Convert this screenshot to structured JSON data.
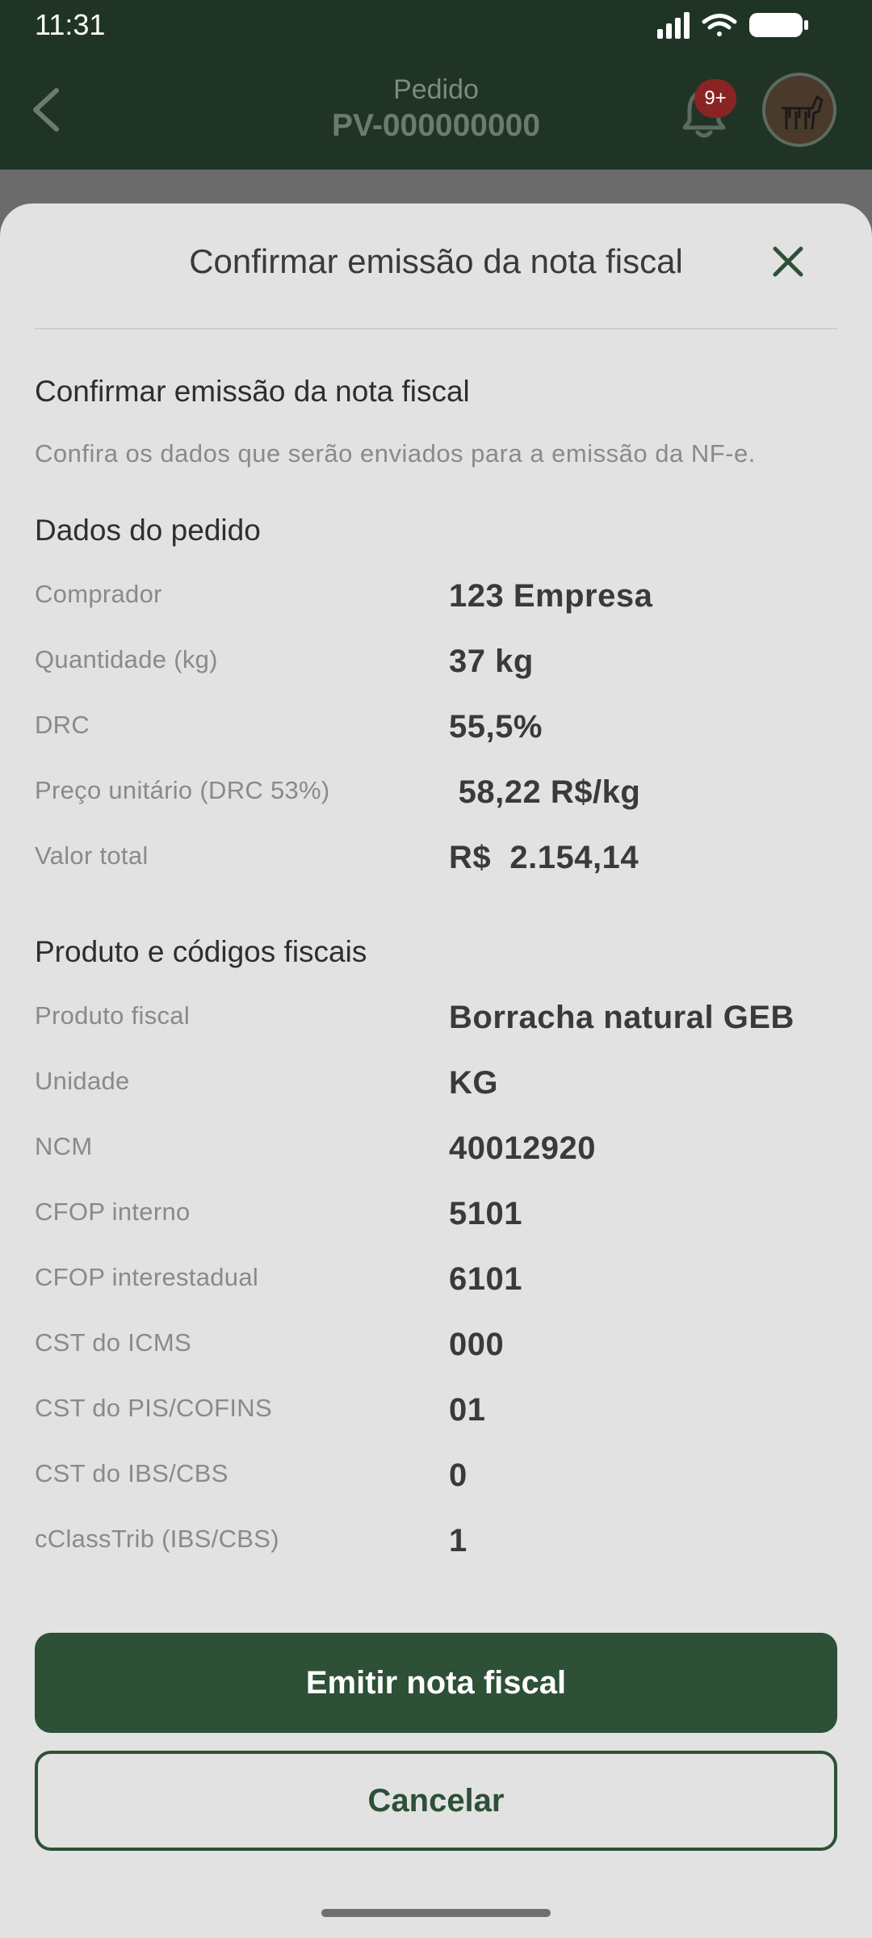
{
  "status_bar": {
    "time": "11:31",
    "icons": [
      "signal-icon",
      "wifi-icon",
      "battery-icon"
    ]
  },
  "header": {
    "subtitle": "Pedido",
    "order_id": "PV-000000000",
    "notification_badge": "9+",
    "back_icon": "chevron-left-icon",
    "bell_icon": "bell-icon",
    "avatar_icon": "zebra-avatar"
  },
  "sheet": {
    "title": "Confirmar emissão da nota fiscal",
    "close_icon": "close-icon",
    "heading": "Confirmar emissão da nota fiscal",
    "description": "Confira os dados que serão enviados para a emissão da NF-e.",
    "order_section": {
      "title": "Dados do pedido",
      "rows": [
        {
          "label": "Comprador",
          "value": "123 Empresa"
        },
        {
          "label": "Quantidade (kg)",
          "value": "37 kg"
        },
        {
          "label": "DRC",
          "value": "55,5%"
        },
        {
          "label": "Preço unitário (DRC 53%)",
          "value": " 58,22 R$/kg"
        },
        {
          "label": "Valor total",
          "value": "R$  2.154,14"
        }
      ]
    },
    "fiscal_section": {
      "title": "Produto e códigos fiscais",
      "rows": [
        {
          "label": "Produto fiscal",
          "value": "Borracha natural GEB"
        },
        {
          "label": "Unidade",
          "value": "KG"
        },
        {
          "label": "NCM",
          "value": "40012920"
        },
        {
          "label": "CFOP interno",
          "value": "5101"
        },
        {
          "label": "CFOP interestadual",
          "value": "6101"
        },
        {
          "label": "CST do ICMS",
          "value": "000"
        },
        {
          "label": "CST do PIS/COFINS",
          "value": "01"
        },
        {
          "label": "CST do IBS/CBS",
          "value": "0"
        },
        {
          "label": "cClassTrib (IBS/CBS)",
          "value": "1"
        }
      ]
    },
    "primary_button": "Emitir nota fiscal",
    "secondary_button": "Cancelar"
  },
  "colors": {
    "header_bg": "#1f3425",
    "sheet_bg": "#e2e2e2",
    "primary": "#2d5037",
    "badge": "#8a2424"
  }
}
